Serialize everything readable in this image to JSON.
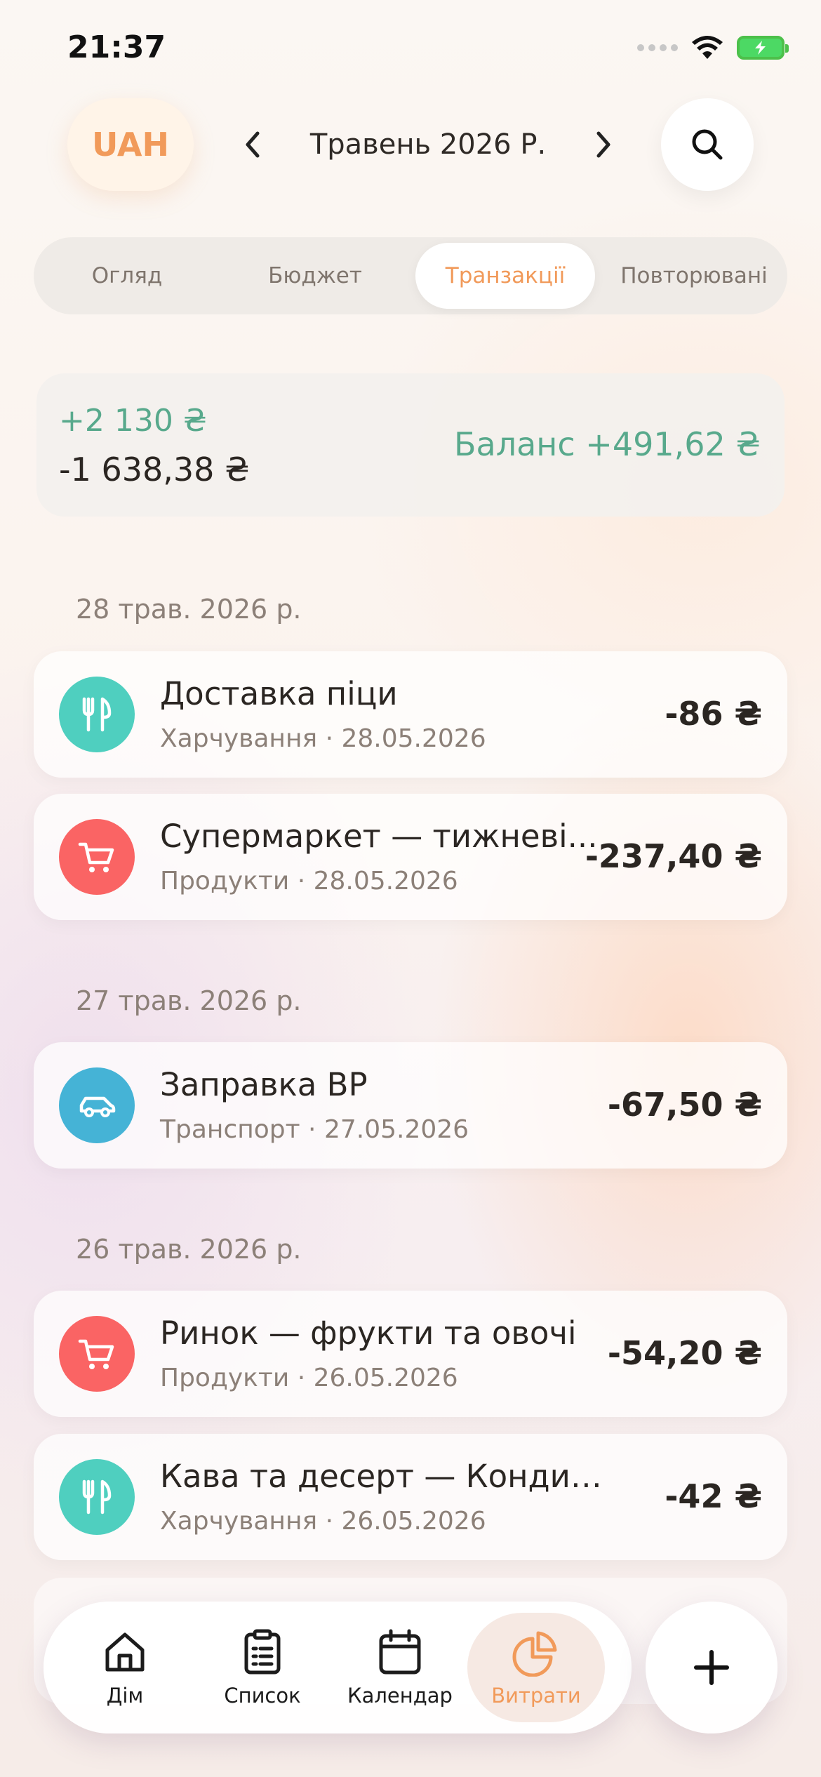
{
  "status_bar": {
    "time": "21:37"
  },
  "header": {
    "currency": "UAH",
    "month": "Травень 2026 Р."
  },
  "tabs": [
    {
      "label": "Огляд"
    },
    {
      "label": "Бюджет"
    },
    {
      "label": "Транзакції"
    },
    {
      "label": "Повторювані"
    }
  ],
  "summary": {
    "income": "+2 130 ₴",
    "expense": "-1 638,38 ₴",
    "balance": "Баланс +491,62 ₴"
  },
  "groups": [
    {
      "date": "28 трав. 2026 р.",
      "transactions": [
        {
          "title": "Доставка піци",
          "subtitle": "Харчування · 28.05.2026",
          "amount": "-86 ₴",
          "icon": "fork-knife-icon",
          "color": "#4fcfbf"
        },
        {
          "title": "Супермаркет — тижневі...",
          "subtitle": "Продукти · 28.05.2026",
          "amount": "-237,40 ₴",
          "icon": "cart-icon",
          "color": "#fa6464"
        }
      ]
    },
    {
      "date": "27 трав. 2026 р.",
      "transactions": [
        {
          "title": "Заправка BP",
          "subtitle": "Транспорт · 27.05.2026",
          "amount": "-67,50 ₴",
          "icon": "car-icon",
          "color": "#45b3d6"
        }
      ]
    },
    {
      "date": "26 трав. 2026 р.",
      "transactions": [
        {
          "title": "Ринок — фрукти та овочі",
          "subtitle": "Продукти · 26.05.2026",
          "amount": "-54,20 ₴",
          "icon": "cart-icon",
          "color": "#fa6464"
        },
        {
          "title": "Кава та десерт — Кондитерс...",
          "subtitle": "Харчування · 26.05.2026",
          "amount": "-42 ₴",
          "icon": "fork-knife-icon",
          "color": "#4fcfbf"
        }
      ]
    }
  ],
  "bottom_nav": [
    {
      "label": "Дім",
      "icon": "home-icon"
    },
    {
      "label": "Список",
      "icon": "clipboard-list-icon"
    },
    {
      "label": "Календар",
      "icon": "calendar-icon"
    },
    {
      "label": "Витрати",
      "icon": "pie-chart-icon"
    }
  ],
  "colors": {
    "accent": "#f19a5a",
    "income": "#58a98c",
    "food": "#4fcfbf",
    "groceries": "#fa6464",
    "transport": "#45b3d6"
  }
}
